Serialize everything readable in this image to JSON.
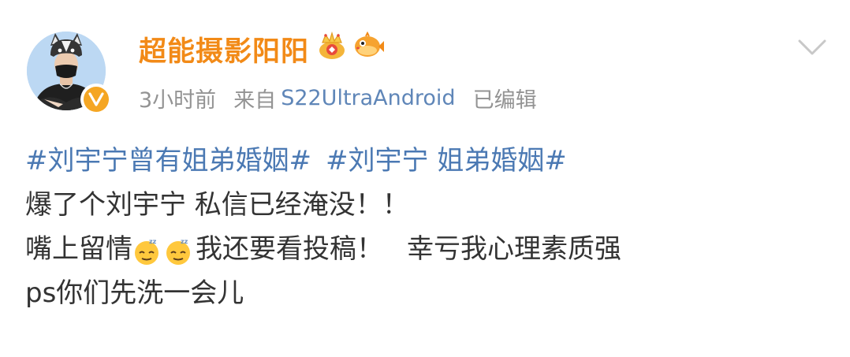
{
  "post": {
    "author": {
      "name": "超能摄影阳阳",
      "badges": [
        "crown-badge-icon",
        "pufferfish-badge-icon"
      ],
      "verified_color": "#f5a623",
      "name_color": "#f28a17"
    },
    "meta": {
      "time": "3小时前",
      "source_prefix": "来自",
      "source_device": "S22UltraAndroid",
      "edited": "已编辑"
    },
    "topics": [
      "#刘宇宁曾有姐弟婚姻#",
      "#刘宇宁 姐弟婚姻#"
    ],
    "lines": {
      "line1": "爆了个刘宇宁 私信已经淹没！！",
      "line2_a": "嘴上留情",
      "line2_emojis": [
        "sleepy-face-emoji-icon",
        "sleepy-face-emoji-icon"
      ],
      "line2_b": "我还要看投稿！",
      "line2_c": "幸亏我心理素质强",
      "line3": "ps你们先洗一会儿"
    },
    "colors": {
      "link": "#4b79b3",
      "meta": "#939393",
      "text": "#333333"
    }
  }
}
